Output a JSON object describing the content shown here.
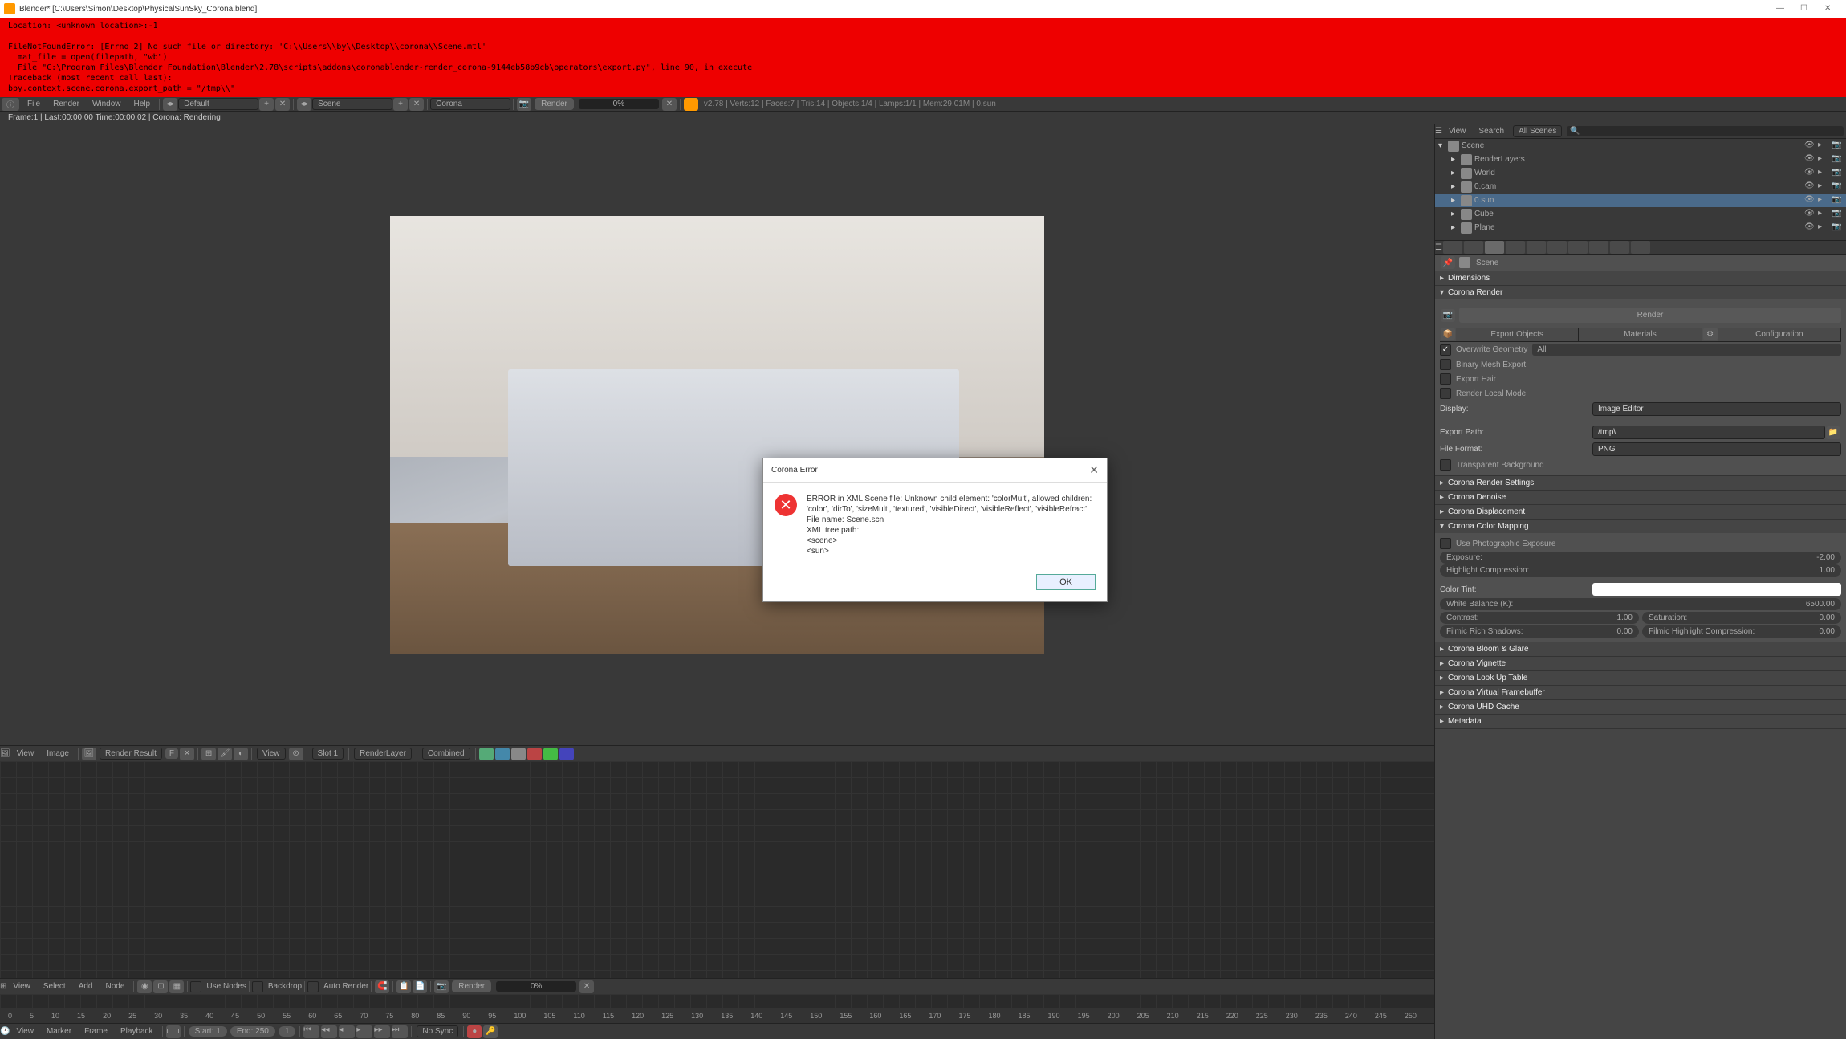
{
  "title": "Blender* [C:\\Users\\Simon\\Desktop\\PhysicalSunSky_Corona.blend]",
  "error_banner": "Location: <unknown location>:-1\n\nFileNotFoundError: [Errno 2] No such file or directory: 'C:\\\\Users\\\\by\\\\Desktop\\\\corona\\\\Scene.mtl'\n  mat_file = open(filepath, \"wb\")\n  File \"C:\\Program Files\\Blender Foundation\\Blender\\2.78\\scripts\\addons\\coronablender-render_corona-9144eb58b9cb\\operators\\export.py\", line 90, in execute\nTraceback (most recent call last):\nbpy.context.scene.corona.export_path = \"/tmp\\\\\"",
  "info": {
    "menus": [
      "File",
      "Render",
      "Window",
      "Help"
    ],
    "layout": "Default",
    "scene": "Scene",
    "engine": "Corona",
    "render_btn": "Render",
    "progress": "0%",
    "stats": "v2.78 | Verts:12 | Faces:7 | Tris:14 | Objects:1/4 | Lamps:1/1 | Mem:29.01M | 0.sun"
  },
  "render_status": "Frame:1 | Last:00:00.00 Time:00:00.02 | Corona: Rendering",
  "image_editor": {
    "menus": [
      "View",
      "Image"
    ],
    "result": "Render Result",
    "view_label": "View",
    "slot": "Slot 1",
    "layer": "RenderLayer",
    "pass": "Combined"
  },
  "node_editor": {
    "menus": [
      "View",
      "Select",
      "Add",
      "Node"
    ],
    "use_nodes": "Use Nodes",
    "backdrop": "Backdrop",
    "auto_render": "Auto Render",
    "render_btn": "Render",
    "progress": "0%"
  },
  "timeline": {
    "menus": [
      "View",
      "Marker",
      "Frame",
      "Playback"
    ],
    "start_label": "Start:",
    "start": "1",
    "end_label": "End:",
    "end": "250",
    "current": "1",
    "sync": "No Sync",
    "ticks": [
      "0",
      "5",
      "10",
      "15",
      "20",
      "25",
      "30",
      "35",
      "40",
      "45",
      "50",
      "55",
      "60",
      "65",
      "70",
      "75",
      "80",
      "85",
      "90",
      "95",
      "100",
      "105",
      "110",
      "115",
      "120",
      "125",
      "130",
      "135",
      "140",
      "145",
      "150",
      "155",
      "160",
      "165",
      "170",
      "175",
      "180",
      "185",
      "190",
      "195",
      "200",
      "205",
      "210",
      "215",
      "220",
      "225",
      "230",
      "235",
      "240",
      "245",
      "250"
    ]
  },
  "outliner": {
    "menus": [
      "View",
      "Search"
    ],
    "filter": "All Scenes",
    "items": [
      {
        "name": "Scene",
        "indent": 0,
        "expanded": true
      },
      {
        "name": "RenderLayers",
        "indent": 1
      },
      {
        "name": "World",
        "indent": 1
      },
      {
        "name": "0.cam",
        "indent": 1
      },
      {
        "name": "0.sun",
        "indent": 1,
        "selected": true
      },
      {
        "name": "Cube",
        "indent": 1
      },
      {
        "name": "Plane",
        "indent": 1
      }
    ]
  },
  "props": {
    "breadcrumb": "Scene",
    "dimensions": "Dimensions",
    "corona_render": "Corona Render",
    "render_btn": "Render",
    "tabs": [
      "Export Objects",
      "Materials",
      "Configuration"
    ],
    "overwrite": "Overwrite Geometry",
    "all": "All",
    "binary": "Binary Mesh Export",
    "export_hair": "Export Hair",
    "render_local": "Render Local Mode",
    "display_label": "Display:",
    "display": "Image Editor",
    "export_path_label": "Export Path:",
    "export_path": "/tmp\\",
    "file_format_label": "File Format:",
    "file_format": "PNG",
    "transparent_bg": "Transparent Background",
    "panels_closed": [
      "Corona Render Settings",
      "Corona Denoise",
      "Corona Displacement"
    ],
    "color_mapping": "Corona Color Mapping",
    "photo_exposure": "Use Photographic Exposure",
    "exposure_label": "Exposure:",
    "exposure": "-2.00",
    "highlight_label": "Highlight Compression:",
    "highlight": "1.00",
    "color_tint_label": "Color Tint:",
    "white_balance_label": "White Balance (K):",
    "white_balance": "6500.00",
    "contrast_label": "Contrast:",
    "contrast": "1.00",
    "saturation_label": "Saturation:",
    "saturation": "0.00",
    "shadows_label": "Filmic Rich Shadows:",
    "shadows": "0.00",
    "filmic_hl_label": "Filmic Highlight Compression:",
    "filmic_hl": "0.00",
    "panels_bottom": [
      "Corona Bloom & Glare",
      "Corona Vignette",
      "Corona Look Up Table",
      "Corona Virtual Framebuffer",
      "Corona UHD Cache",
      "Metadata"
    ]
  },
  "dialog": {
    "title": "Corona Error",
    "text": "ERROR in XML Scene file: Unknown child element: 'colorMult', allowed children: 'color', 'dirTo', 'sizeMult', 'textured', 'visibleDirect', 'visibleReflect', 'visibleRefract'\nFile name: Scene.scn\nXML tree path:\n  <scene>\n    <sun>",
    "ok": "OK"
  }
}
